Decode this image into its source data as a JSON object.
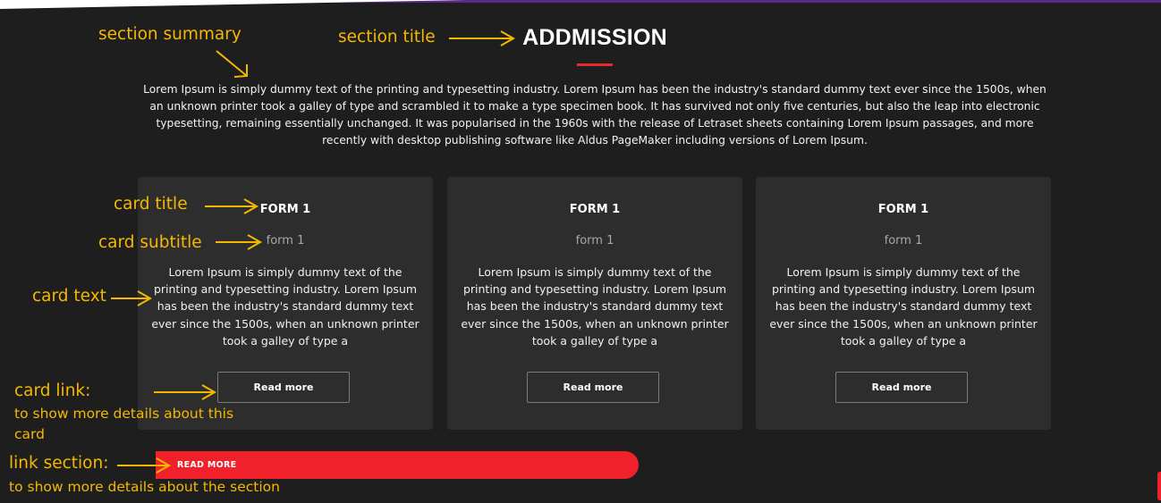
{
  "section": {
    "title": "ADDMISSION",
    "summary": "Lorem Ipsum is simply dummy text of the printing and typesetting industry. Lorem Ipsum has been the industry's standard dummy text ever since the 1500s, when an unknown printer took a galley of type and scrambled it to make a type specimen book. It has survived not only five centuries, but also the leap into electronic typesetting, remaining essentially unchanged. It was popularised in the 1960s with the release of Letraset sheets containing Lorem Ipsum passages, and more recently with desktop publishing software like Aldus PageMaker including versions of Lorem Ipsum.",
    "link_label": "READ MORE"
  },
  "cards": [
    {
      "title": "FORM 1",
      "subtitle": "form 1",
      "text": "Lorem Ipsum is simply dummy text of the printing and typesetting industry. Lorem Ipsum has been the industry's standard dummy text ever since the 1500s, when an unknown printer took a galley of type a",
      "link_label": "Read more"
    },
    {
      "title": "FORM 1",
      "subtitle": "form 1",
      "text": "Lorem Ipsum is simply dummy text of the printing and typesetting industry. Lorem Ipsum has been the industry's standard dummy text ever since the 1500s, when an unknown printer took a galley of type a",
      "link_label": "Read more"
    },
    {
      "title": "FORM 1",
      "subtitle": "form 1",
      "text": "Lorem Ipsum is simply dummy text of the printing and typesetting industry. Lorem Ipsum has been the industry's standard dummy text ever since the 1500s, when an unknown printer took a galley of type a",
      "link_label": "Read more"
    }
  ],
  "annotations": {
    "section_summary": "section summary",
    "section_title": "section title",
    "card_title": "card title",
    "card_subtitle": "card subtitle",
    "card_text": "card text",
    "card_link": "card link:",
    "card_link_note": "to show more details about this card",
    "link_section": "link section:",
    "link_section_note": "to show more details about the section"
  },
  "colors": {
    "background": "#1e1e1e",
    "card": "#2d2d2d",
    "accent_red": "#f0212b",
    "annotation": "#f5b800",
    "top_bar": "#5b2a86"
  }
}
